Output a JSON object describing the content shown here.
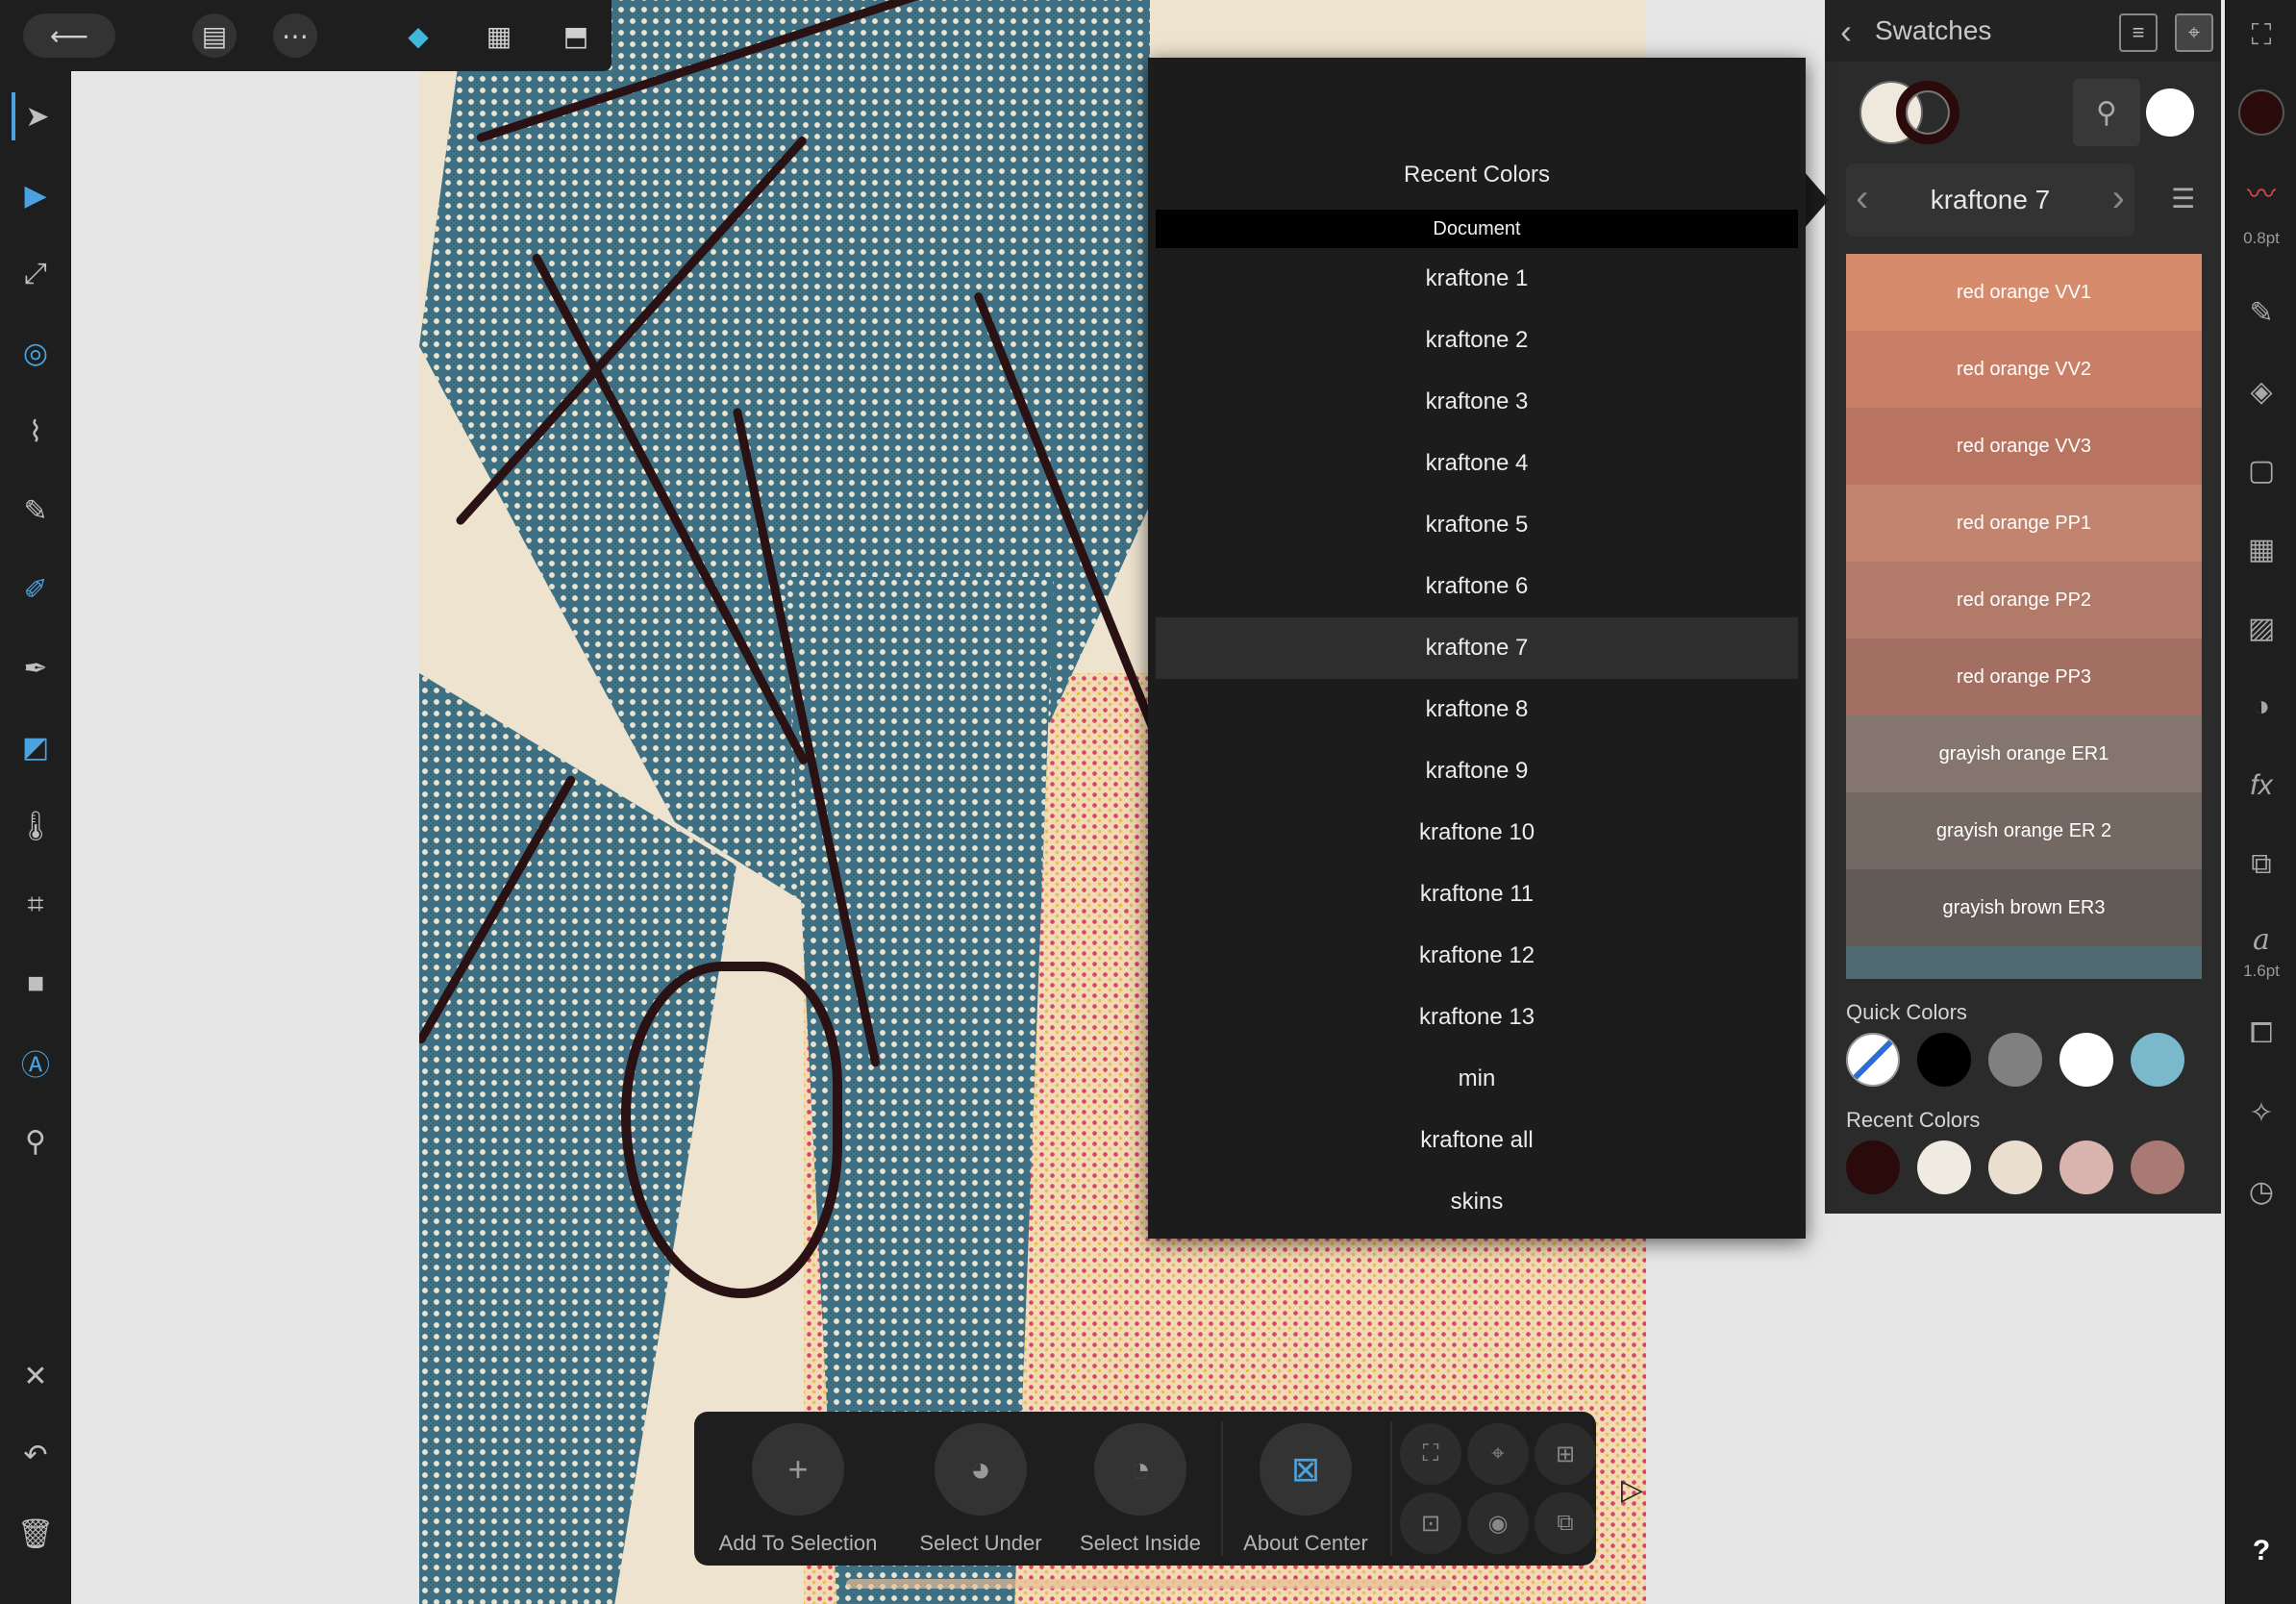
{
  "topbar": {
    "back_icon": "back-arrow-icon",
    "items": [
      "document-icon",
      "more-icon",
      "persona-icon",
      "grid-icon",
      "export-icon"
    ]
  },
  "left_tools": [
    "move-tool-icon",
    "node-tool-icon",
    "point-transform-icon",
    "corner-tool-icon",
    "pen-tool-icon",
    "pencil-icon",
    "vector-brush-icon",
    "fill-tool-icon",
    "transparency-icon",
    "crop-icon",
    "rectangle-icon",
    "text-tool-icon",
    "color-picker-icon",
    "close-icon",
    "undo-icon",
    "trash-icon"
  ],
  "swatches_panel": {
    "title": "Swatches",
    "palette_name": "kraftone 7",
    "swatches": [
      {
        "name": "red orange VV1",
        "color": "#d68b6d"
      },
      {
        "name": "red orange VV2",
        "color": "#c97f67"
      },
      {
        "name": "red orange VV3",
        "color": "#b87461"
      },
      {
        "name": "red orange PP1",
        "color": "#c2846e"
      },
      {
        "name": "red orange PP2",
        "color": "#b27a69"
      },
      {
        "name": "red orange PP3",
        "color": "#a26f62"
      },
      {
        "name": "grayish orange ER1",
        "color": "#85756f"
      },
      {
        "name": "grayish orange ER 2",
        "color": "#746863"
      },
      {
        "name": "grayish brown ER3",
        "color": "#625a56"
      },
      {
        "name": "",
        "color": "#4f6a70"
      }
    ],
    "quick_colors_label": "Quick Colors",
    "quick_colors": [
      "none",
      "#000000",
      "#808080",
      "#ffffff",
      "#7ab9cc"
    ],
    "recent_colors_label": "Recent Colors",
    "recent_colors": [
      "#2b0a0c",
      "#f0ebe2",
      "#eadfcf",
      "#d9b3ad",
      "#a97a73"
    ]
  },
  "right_column": {
    "stroke_width": "0.8pt",
    "font_size": "1.6pt",
    "help": "?"
  },
  "popover": {
    "recent_label": "Recent Colors",
    "document_label": "Document",
    "items": [
      "kraftone 1",
      "kraftone 2",
      "kraftone 3",
      "kraftone 4",
      "kraftone 5",
      "kraftone 6",
      "kraftone 7",
      "kraftone 8",
      "kraftone 9",
      "kraftone 10",
      "kraftone 11",
      "kraftone 12",
      "kraftone 13",
      "min",
      "kraftone all",
      "skins"
    ],
    "selected": "kraftone 7"
  },
  "context_toolbar": {
    "add_to_selection": "Add To Selection",
    "select_under": "Select Under",
    "select_inside": "Select Inside",
    "about_center": "About Center"
  }
}
